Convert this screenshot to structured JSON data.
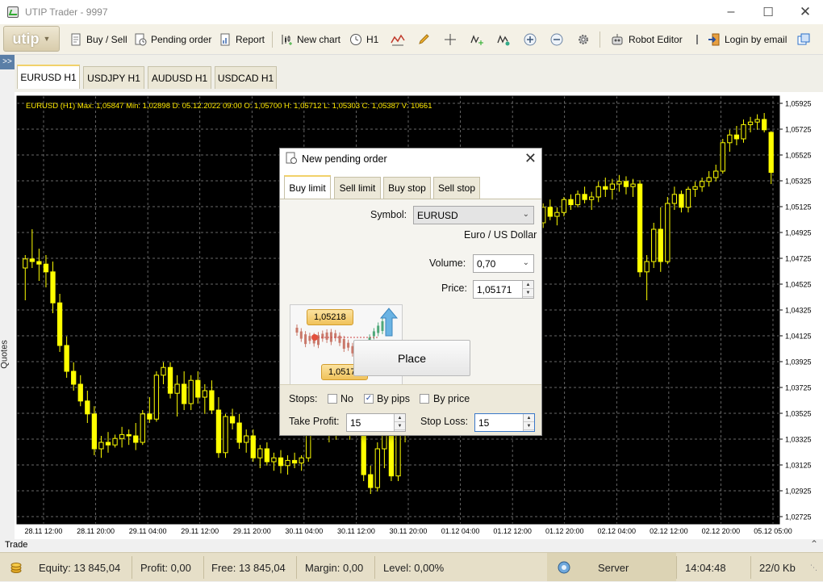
{
  "window": {
    "title": "UTIP Trader - 9997"
  },
  "toolbar": {
    "brand": "utip",
    "buy_sell": "Buy / Sell",
    "pending_order": "Pending order",
    "report": "Report",
    "new_chart": "New chart",
    "timeframe": "H1",
    "robot_editor": "Robot Editor",
    "login_by_email": "Login by email"
  },
  "sidebar": {
    "quotes_label": "Quotes"
  },
  "chart_tabs": [
    {
      "label": "EURUSD  H1",
      "active": true
    },
    {
      "label": "USDJPY  H1",
      "active": false
    },
    {
      "label": "AUDUSD  H1",
      "active": false
    },
    {
      "label": "USDCAD  H1",
      "active": false
    }
  ],
  "chart": {
    "info": "EURUSD (H1)  Max: 1,05847  Min: 1,02898  D: 05.12.2022 09:00  O: 1,05700  H: 1,05712  L: 1,05303  C: 1,05387  V: 10661"
  },
  "chart_data": {
    "type": "candlestick",
    "symbol": "EURUSD",
    "timeframe": "H1",
    "ylim": [
      1.02725,
      1.05925
    ],
    "y_ticks": [
      "1,05925",
      "1,05725",
      "1,05525",
      "1,05325",
      "1,05125",
      "1,04925",
      "1,04725",
      "1,04525",
      "1,04325",
      "1,04125",
      "1,03925",
      "1,03725",
      "1,03525",
      "1,03325",
      "1,03125",
      "1,02925",
      "1,02725"
    ],
    "x_ticks": [
      "28.11 12:00",
      "28.11 20:00",
      "29.11 04:00",
      "29.11 12:00",
      "29.11 20:00",
      "30.11 04:00",
      "30.11 12:00",
      "30.11 20:00",
      "01.12 04:00",
      "01.12 12:00",
      "01.12 20:00",
      "02.12 04:00",
      "02.12 12:00",
      "02.12 20:00",
      "05.12 05:00"
    ],
    "colors": {
      "background": "#000000",
      "candle": "#ffff00",
      "grid": "#8c8c8c"
    },
    "grid": true,
    "max": 1.05847,
    "min": 1.02898,
    "last_candle": {
      "date": "05.12.2022 09:00",
      "open": 1.057,
      "high": 1.05712,
      "low": 1.05303,
      "close": 1.05387,
      "volume": 10661
    },
    "ohlc": [
      [
        1.0465,
        1.0475,
        1.044,
        1.0472
      ],
      [
        1.0472,
        1.0495,
        1.0465,
        1.047
      ],
      [
        1.047,
        1.048,
        1.0455,
        1.0468
      ],
      [
        1.0468,
        1.0475,
        1.045,
        1.0462
      ],
      [
        1.0462,
        1.047,
        1.043,
        1.0438
      ],
      [
        1.0438,
        1.0445,
        1.04,
        1.0405
      ],
      [
        1.0405,
        1.0412,
        1.038,
        1.0385
      ],
      [
        1.0385,
        1.0392,
        1.037,
        1.0375
      ],
      [
        1.0375,
        1.0382,
        1.0358,
        1.0362
      ],
      [
        1.0362,
        1.037,
        1.0345,
        1.0352
      ],
      [
        1.0352,
        1.0358,
        1.032,
        1.0325
      ],
      [
        1.0325,
        1.0335,
        1.0318,
        1.033
      ],
      [
        1.033,
        1.0338,
        1.0322,
        1.0328
      ],
      [
        1.0328,
        1.0336,
        1.0326,
        1.0333
      ],
      [
        1.0333,
        1.0342,
        1.0326,
        1.0336
      ],
      [
        1.0336,
        1.034,
        1.0328,
        1.0335
      ],
      [
        1.0335,
        1.0345,
        1.0324,
        1.033
      ],
      [
        1.033,
        1.0355,
        1.0328,
        1.0352
      ],
      [
        1.0352,
        1.0365,
        1.0345,
        1.0348
      ],
      [
        1.0348,
        1.0385,
        1.0346,
        1.0382
      ],
      [
        1.0382,
        1.0392,
        1.0375,
        1.0388
      ],
      [
        1.0388,
        1.0392,
        1.0364,
        1.0368
      ],
      [
        1.0368,
        1.0382,
        1.035,
        1.0375
      ],
      [
        1.0375,
        1.0385,
        1.0355,
        1.036
      ],
      [
        1.036,
        1.0382,
        1.0355,
        1.0378
      ],
      [
        1.0378,
        1.0385,
        1.036,
        1.0365
      ],
      [
        1.0365,
        1.0375,
        1.0352,
        1.037
      ],
      [
        1.037,
        1.0378,
        1.0352,
        1.0355
      ],
      [
        1.0355,
        1.0365,
        1.0318,
        1.0322
      ],
      [
        1.0322,
        1.0352,
        1.0318,
        1.035
      ],
      [
        1.035,
        1.0356,
        1.034,
        1.0345
      ],
      [
        1.0345,
        1.0352,
        1.0325,
        1.033
      ],
      [
        1.033,
        1.034,
        1.0322,
        1.0335
      ],
      [
        1.0335,
        1.034,
        1.0315,
        1.0318
      ],
      [
        1.0318,
        1.0328,
        1.031,
        1.0325
      ],
      [
        1.0325,
        1.033,
        1.0312,
        1.0315
      ],
      [
        1.0315,
        1.0322,
        1.0308,
        1.0318
      ],
      [
        1.0318,
        1.0324,
        1.0306,
        1.0312
      ],
      [
        1.0312,
        1.032,
        1.0305,
        1.0316
      ],
      [
        1.0316,
        1.0322,
        1.031,
        1.0314
      ],
      [
        1.0314,
        1.032,
        1.0308,
        1.0318
      ],
      [
        1.0318,
        1.0345,
        1.0315,
        1.0342
      ],
      [
        1.0342,
        1.035,
        1.0338,
        1.0346
      ],
      [
        1.034,
        1.035,
        1.0335,
        1.0345
      ],
      [
        1.0345,
        1.0352,
        1.033,
        1.0338
      ],
      [
        1.0338,
        1.0348,
        1.0332,
        1.0344
      ],
      [
        1.0344,
        1.035,
        1.0335,
        1.034
      ],
      [
        1.034,
        1.0346,
        1.0332,
        1.0342
      ],
      [
        1.0342,
        1.035,
        1.0336,
        1.0344
      ],
      [
        1.0344,
        1.035,
        1.03,
        1.0305
      ],
      [
        1.0305,
        1.0312,
        1.029,
        1.0295
      ],
      [
        1.0295,
        1.033,
        1.0292,
        1.0325
      ],
      [
        1.0325,
        1.0345,
        1.031,
        1.034
      ],
      [
        1.034,
        1.0345,
        1.03,
        1.0304
      ],
      [
        1.0304,
        1.0345,
        1.03,
        1.034
      ],
      [
        1.034,
        1.035,
        1.033,
        1.0345
      ],
      [
        1.0345,
        1.036,
        1.034,
        1.0355
      ],
      [
        1.0355,
        1.038,
        1.035,
        1.0375
      ],
      [
        1.0375,
        1.04,
        1.037,
        1.0395
      ],
      [
        1.0395,
        1.042,
        1.039,
        1.0415
      ],
      [
        1.0415,
        1.044,
        1.041,
        1.0435
      ],
      [
        1.0435,
        1.046,
        1.043,
        1.0455
      ],
      [
        1.0455,
        1.048,
        1.045,
        1.0475
      ],
      [
        1.0475,
        1.0495,
        1.047,
        1.049
      ],
      [
        1.049,
        1.051,
        1.0485,
        1.0505
      ],
      [
        1.0505,
        1.052,
        1.05,
        1.0515
      ],
      [
        1.0515,
        1.052,
        1.0505,
        1.051
      ],
      [
        1.051,
        1.052,
        1.0498,
        1.0503
      ],
      [
        1.0503,
        1.0522,
        1.05,
        1.0518
      ],
      [
        1.0518,
        1.0522,
        1.051,
        1.0512
      ],
      [
        1.0512,
        1.052,
        1.0508,
        1.0516
      ],
      [
        1.0516,
        1.0522,
        1.0512,
        1.0518
      ],
      [
        1.0518,
        1.0524,
        1.0514,
        1.052
      ],
      [
        1.052,
        1.0525,
        1.0515,
        1.0522
      ],
      [
        1.0522,
        1.0528,
        1.0498,
        1.05
      ],
      [
        1.05,
        1.0515,
        1.0496,
        1.0512
      ],
      [
        1.0512,
        1.0518,
        1.0502,
        1.0505
      ],
      [
        1.0505,
        1.0512,
        1.0498,
        1.0508
      ],
      [
        1.0508,
        1.052,
        1.0505,
        1.0518
      ],
      [
        1.0518,
        1.0522,
        1.051,
        1.0514
      ],
      [
        1.0514,
        1.0525,
        1.0512,
        1.0522
      ],
      [
        1.0522,
        1.0528,
        1.0515,
        1.0518
      ],
      [
        1.0518,
        1.0524,
        1.051,
        1.052
      ],
      [
        1.052,
        1.0532,
        1.0516,
        1.0528
      ],
      [
        1.0528,
        1.0535,
        1.052,
        1.0526
      ],
      [
        1.0526,
        1.0534,
        1.0518,
        1.053
      ],
      [
        1.053,
        1.0537,
        1.0524,
        1.0532
      ],
      [
        1.0532,
        1.0536,
        1.0522,
        1.0528
      ],
      [
        1.0528,
        1.0534,
        1.052,
        1.053
      ],
      [
        1.053,
        1.0533,
        1.0458,
        1.0462
      ],
      [
        1.0462,
        1.0475,
        1.044,
        1.047
      ],
      [
        1.047,
        1.05,
        1.0465,
        1.0495
      ],
      [
        1.0495,
        1.0512,
        1.0462,
        1.047
      ],
      [
        1.047,
        1.052,
        1.0468,
        1.0515
      ],
      [
        1.0515,
        1.0528,
        1.051,
        1.0522
      ],
      [
        1.0522,
        1.0525,
        1.0508,
        1.0512
      ],
      [
        1.0512,
        1.0528,
        1.0508,
        1.0526
      ],
      [
        1.0526,
        1.0532,
        1.052,
        1.0528
      ],
      [
        1.0528,
        1.0535,
        1.0524,
        1.0532
      ],
      [
        1.0532,
        1.054,
        1.0528,
        1.0535
      ],
      [
        1.0535,
        1.0545,
        1.0532,
        1.054
      ],
      [
        1.054,
        1.0565,
        1.0538,
        1.0562
      ],
      [
        1.0562,
        1.0572,
        1.0555,
        1.0568
      ],
      [
        1.0568,
        1.0575,
        1.056,
        1.0565
      ],
      [
        1.0565,
        1.058,
        1.0562,
        1.0576
      ],
      [
        1.0576,
        1.0582,
        1.057,
        1.0578
      ],
      [
        1.0578,
        1.0584,
        1.0572,
        1.058
      ],
      [
        1.058,
        1.0585,
        1.057,
        1.0572
      ],
      [
        1.057,
        1.0571,
        1.053,
        1.0539
      ]
    ]
  },
  "dialog": {
    "title": "New pending order",
    "tabs": [
      "Buy limit",
      "Sell limit",
      "Buy stop",
      "Sell stop"
    ],
    "active_tab": "Buy limit",
    "symbol_label": "Symbol:",
    "symbol_value": "EURUSD",
    "symbol_desc": "Euro / US Dollar",
    "volume_label": "Volume:",
    "volume_value": "0,70",
    "price_label": "Price:",
    "price_value": "1,05171",
    "illus_price_top": "1,05218",
    "illus_price_bottom": "1,05171",
    "place_button": "Place",
    "stops_label": "Stops:",
    "stops_options": [
      {
        "label": "No",
        "checked": false
      },
      {
        "label": "By pips",
        "checked": true
      },
      {
        "label": "By price",
        "checked": false
      }
    ],
    "take_profit_label": "Take Profit:",
    "take_profit_value": "15",
    "stop_loss_label": "Stop Loss:",
    "stop_loss_value": "15"
  },
  "trade_tab": "Trade",
  "status": {
    "equity": "Equity: 13 845,04",
    "profit": "Profit: 0,00",
    "free": "Free: 13 845,04",
    "margin": "Margin: 0,00",
    "level": "Level: 0,00%",
    "server": "Server",
    "time": "14:04:48",
    "traffic": "22/0 Kb"
  }
}
